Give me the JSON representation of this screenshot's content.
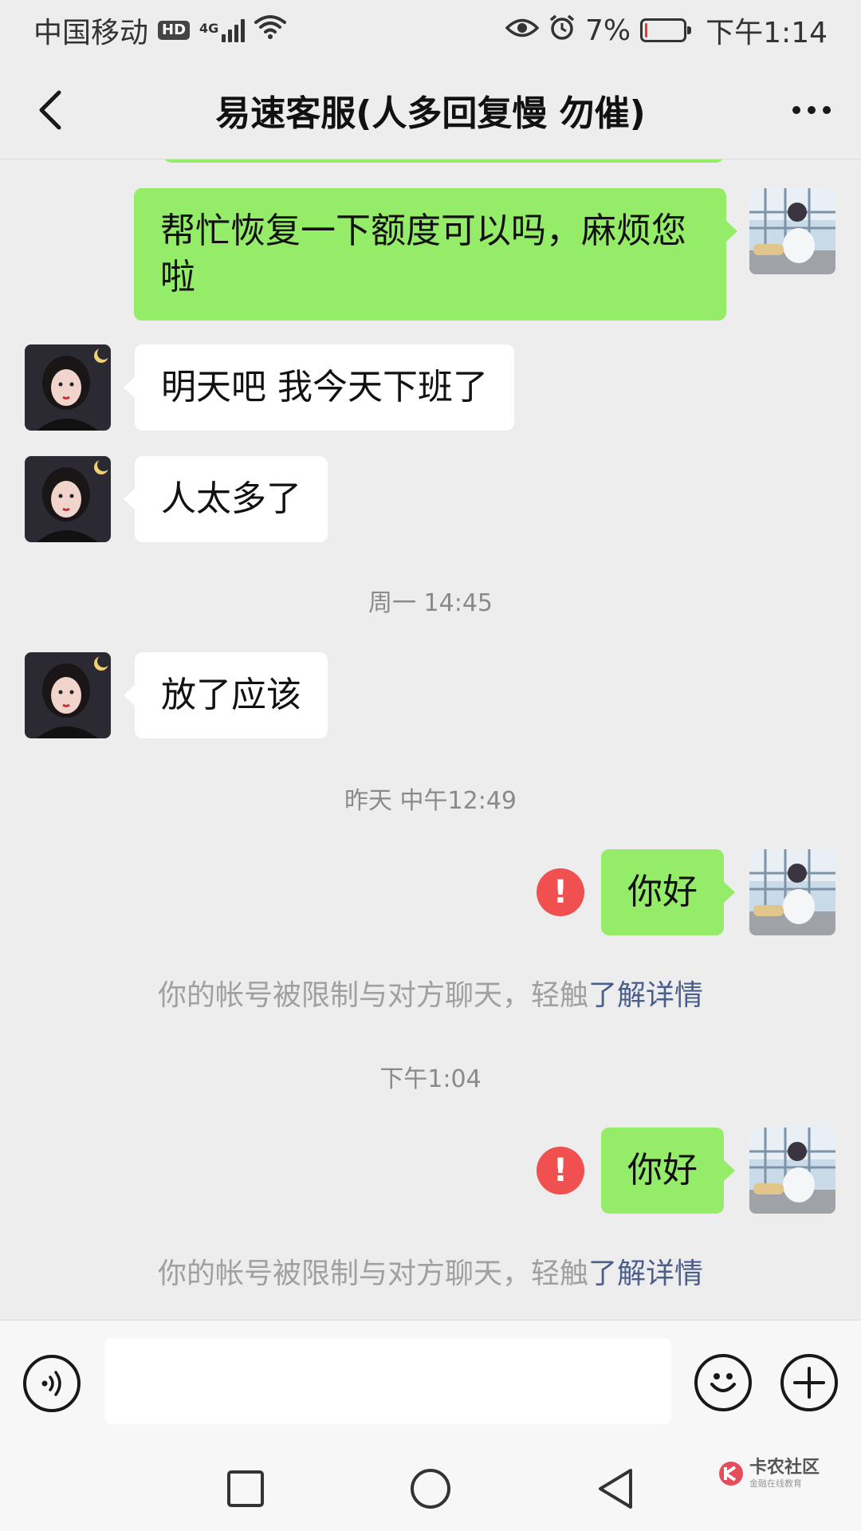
{
  "status_bar": {
    "carrier": "中国移动",
    "hd": "HD",
    "network": "4G",
    "battery_percent": "7%",
    "battery_level": 0.07,
    "time": "下午1:14",
    "icons": [
      "eye-icon",
      "alarm-icon",
      "wifi-icon",
      "signal-icon",
      "battery-icon"
    ]
  },
  "header": {
    "title": "易速客服(人多回复慢 勿催)",
    "back_icon": "chevron-left-icon",
    "more_icon": "more-icon"
  },
  "messages": [
    {
      "side": "right",
      "text": "帮忙恢复一下额度可以吗，麻烦您啦"
    },
    {
      "side": "left",
      "text": "明天吧 我今天下班了"
    },
    {
      "side": "left",
      "text": "人太多了"
    },
    {
      "type": "timestamp",
      "text": "周一 14:45"
    },
    {
      "side": "left",
      "text": "放了应该"
    },
    {
      "type": "timestamp",
      "text": "昨天 中午12:49"
    },
    {
      "side": "right",
      "text": "你好",
      "failed": true
    },
    {
      "type": "notice",
      "text": "你的帐号被限制与对方聊天，轻触",
      "link": "了解详情"
    },
    {
      "type": "timestamp",
      "text": "下午1:04"
    },
    {
      "side": "right",
      "text": "你好",
      "failed": true
    },
    {
      "type": "notice",
      "text": "你的帐号被限制与对方聊天，轻触",
      "link": "了解详情"
    }
  ],
  "input_bar": {
    "voice_icon": "voice-icon",
    "emoji_icon": "emoji-icon",
    "plus_icon": "plus-icon",
    "value": ""
  },
  "error_mark": "!",
  "nav_bar": {
    "icons": [
      "square-icon",
      "circle-icon",
      "triangle-back-icon"
    ]
  },
  "watermark": {
    "name": "卡农社区",
    "tagline": "金融在线教育"
  },
  "colors": {
    "background": "#ededed",
    "self_bubble": "#95ec69",
    "other_bubble": "#ffffff",
    "error": "#f05050",
    "link": "#4b5e8c"
  }
}
